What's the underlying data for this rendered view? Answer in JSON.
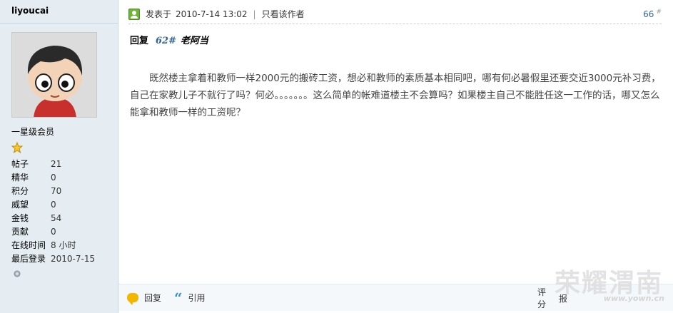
{
  "user": {
    "name": "liyoucai",
    "group": "一星级会员",
    "stats": [
      {
        "label": "帖子",
        "value": "21"
      },
      {
        "label": "精华",
        "value": "0"
      },
      {
        "label": "积分",
        "value": "70"
      },
      {
        "label": "威望",
        "value": "0"
      },
      {
        "label": "金钱",
        "value": "54"
      },
      {
        "label": "贡献",
        "value": "0"
      },
      {
        "label": "在线时间",
        "value": "8 小时"
      },
      {
        "label": "最后登录",
        "value": "2010-7-15"
      }
    ]
  },
  "post": {
    "posted_prefix": "发表于",
    "posted_time": "2010-7-14 13:02",
    "separator": "|",
    "only_author": "只看该作者",
    "floor": "66",
    "floor_mark": "#",
    "reply_label": "回复",
    "reply_num": "62#",
    "reply_author": "老阿当",
    "body": "既然楼主拿着和教师一样2000元的搬砖工资，想必和教师的素质基本相同吧，哪有何必暑假里还要交近3000元补习费，自己在家教儿子不就行了吗？何必。。。。。。。这么简单的帐难道楼主不会算吗？如果楼主自己不能胜任这一工作的话，哪又怎么能拿和教师一样的工资呢？"
  },
  "footer": {
    "reply": "回复",
    "quote": "引用",
    "rate": "评分",
    "report": "报"
  },
  "watermark": {
    "text": "荣耀渭南",
    "url": "www.yown.cn"
  }
}
